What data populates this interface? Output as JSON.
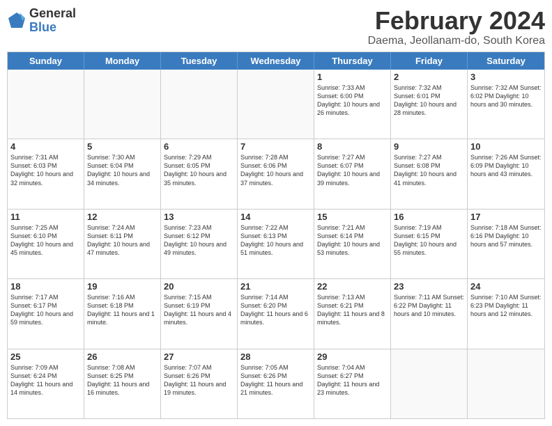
{
  "logo": {
    "general": "General",
    "blue": "Blue"
  },
  "title": "February 2024",
  "subtitle": "Daema, Jeollanam-do, South Korea",
  "headers": [
    "Sunday",
    "Monday",
    "Tuesday",
    "Wednesday",
    "Thursday",
    "Friday",
    "Saturday"
  ],
  "weeks": [
    [
      {
        "date": "",
        "info": ""
      },
      {
        "date": "",
        "info": ""
      },
      {
        "date": "",
        "info": ""
      },
      {
        "date": "",
        "info": ""
      },
      {
        "date": "1",
        "info": "Sunrise: 7:33 AM\nSunset: 6:00 PM\nDaylight: 10 hours\nand 26 minutes."
      },
      {
        "date": "2",
        "info": "Sunrise: 7:32 AM\nSunset: 6:01 PM\nDaylight: 10 hours\nand 28 minutes."
      },
      {
        "date": "3",
        "info": "Sunrise: 7:32 AM\nSunset: 6:02 PM\nDaylight: 10 hours\nand 30 minutes."
      }
    ],
    [
      {
        "date": "4",
        "info": "Sunrise: 7:31 AM\nSunset: 6:03 PM\nDaylight: 10 hours\nand 32 minutes."
      },
      {
        "date": "5",
        "info": "Sunrise: 7:30 AM\nSunset: 6:04 PM\nDaylight: 10 hours\nand 34 minutes."
      },
      {
        "date": "6",
        "info": "Sunrise: 7:29 AM\nSunset: 6:05 PM\nDaylight: 10 hours\nand 35 minutes."
      },
      {
        "date": "7",
        "info": "Sunrise: 7:28 AM\nSunset: 6:06 PM\nDaylight: 10 hours\nand 37 minutes."
      },
      {
        "date": "8",
        "info": "Sunrise: 7:27 AM\nSunset: 6:07 PM\nDaylight: 10 hours\nand 39 minutes."
      },
      {
        "date": "9",
        "info": "Sunrise: 7:27 AM\nSunset: 6:08 PM\nDaylight: 10 hours\nand 41 minutes."
      },
      {
        "date": "10",
        "info": "Sunrise: 7:26 AM\nSunset: 6:09 PM\nDaylight: 10 hours\nand 43 minutes."
      }
    ],
    [
      {
        "date": "11",
        "info": "Sunrise: 7:25 AM\nSunset: 6:10 PM\nDaylight: 10 hours\nand 45 minutes."
      },
      {
        "date": "12",
        "info": "Sunrise: 7:24 AM\nSunset: 6:11 PM\nDaylight: 10 hours\nand 47 minutes."
      },
      {
        "date": "13",
        "info": "Sunrise: 7:23 AM\nSunset: 6:12 PM\nDaylight: 10 hours\nand 49 minutes."
      },
      {
        "date": "14",
        "info": "Sunrise: 7:22 AM\nSunset: 6:13 PM\nDaylight: 10 hours\nand 51 minutes."
      },
      {
        "date": "15",
        "info": "Sunrise: 7:21 AM\nSunset: 6:14 PM\nDaylight: 10 hours\nand 53 minutes."
      },
      {
        "date": "16",
        "info": "Sunrise: 7:19 AM\nSunset: 6:15 PM\nDaylight: 10 hours\nand 55 minutes."
      },
      {
        "date": "17",
        "info": "Sunrise: 7:18 AM\nSunset: 6:16 PM\nDaylight: 10 hours\nand 57 minutes."
      }
    ],
    [
      {
        "date": "18",
        "info": "Sunrise: 7:17 AM\nSunset: 6:17 PM\nDaylight: 10 hours\nand 59 minutes."
      },
      {
        "date": "19",
        "info": "Sunrise: 7:16 AM\nSunset: 6:18 PM\nDaylight: 11 hours\nand 1 minute."
      },
      {
        "date": "20",
        "info": "Sunrise: 7:15 AM\nSunset: 6:19 PM\nDaylight: 11 hours\nand 4 minutes."
      },
      {
        "date": "21",
        "info": "Sunrise: 7:14 AM\nSunset: 6:20 PM\nDaylight: 11 hours\nand 6 minutes."
      },
      {
        "date": "22",
        "info": "Sunrise: 7:13 AM\nSunset: 6:21 PM\nDaylight: 11 hours\nand 8 minutes."
      },
      {
        "date": "23",
        "info": "Sunrise: 7:11 AM\nSunset: 6:22 PM\nDaylight: 11 hours\nand 10 minutes."
      },
      {
        "date": "24",
        "info": "Sunrise: 7:10 AM\nSunset: 6:23 PM\nDaylight: 11 hours\nand 12 minutes."
      }
    ],
    [
      {
        "date": "25",
        "info": "Sunrise: 7:09 AM\nSunset: 6:24 PM\nDaylight: 11 hours\nand 14 minutes."
      },
      {
        "date": "26",
        "info": "Sunrise: 7:08 AM\nSunset: 6:25 PM\nDaylight: 11 hours\nand 16 minutes."
      },
      {
        "date": "27",
        "info": "Sunrise: 7:07 AM\nSunset: 6:26 PM\nDaylight: 11 hours\nand 19 minutes."
      },
      {
        "date": "28",
        "info": "Sunrise: 7:05 AM\nSunset: 6:26 PM\nDaylight: 11 hours\nand 21 minutes."
      },
      {
        "date": "29",
        "info": "Sunrise: 7:04 AM\nSunset: 6:27 PM\nDaylight: 11 hours\nand 23 minutes."
      },
      {
        "date": "",
        "info": ""
      },
      {
        "date": "",
        "info": ""
      }
    ]
  ]
}
